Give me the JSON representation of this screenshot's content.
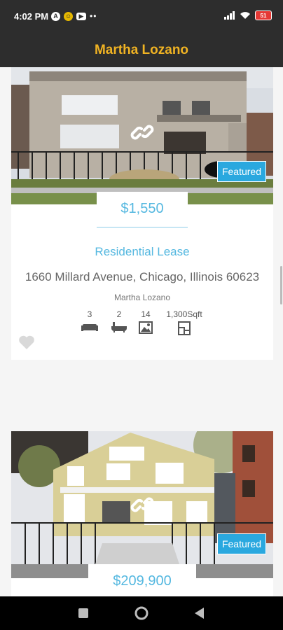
{
  "status_bar": {
    "time": "4:02 PM",
    "battery": "51",
    "icons": [
      "a-circle-icon",
      "yellow-app-icon",
      "youtube-icon",
      "more-dots-icon",
      "signal-icon",
      "wifi-icon",
      "battery-icon"
    ]
  },
  "app_bar": {
    "title": "Martha Lozano"
  },
  "listings": [
    {
      "badge": "Featured",
      "price": "$1,550",
      "category": "Residential Lease",
      "address": "1660 Millard Avenue, Chicago, Illinois 60623",
      "agent": "Martha Lozano",
      "beds": "3",
      "baths": "2",
      "photos": "14",
      "area": "1,300Sqft"
    },
    {
      "badge": "Featured",
      "price": "$209,900"
    }
  ],
  "colors": {
    "accent": "#2aa8df",
    "title": "#f0b323",
    "bar": "#2d2d2d"
  }
}
